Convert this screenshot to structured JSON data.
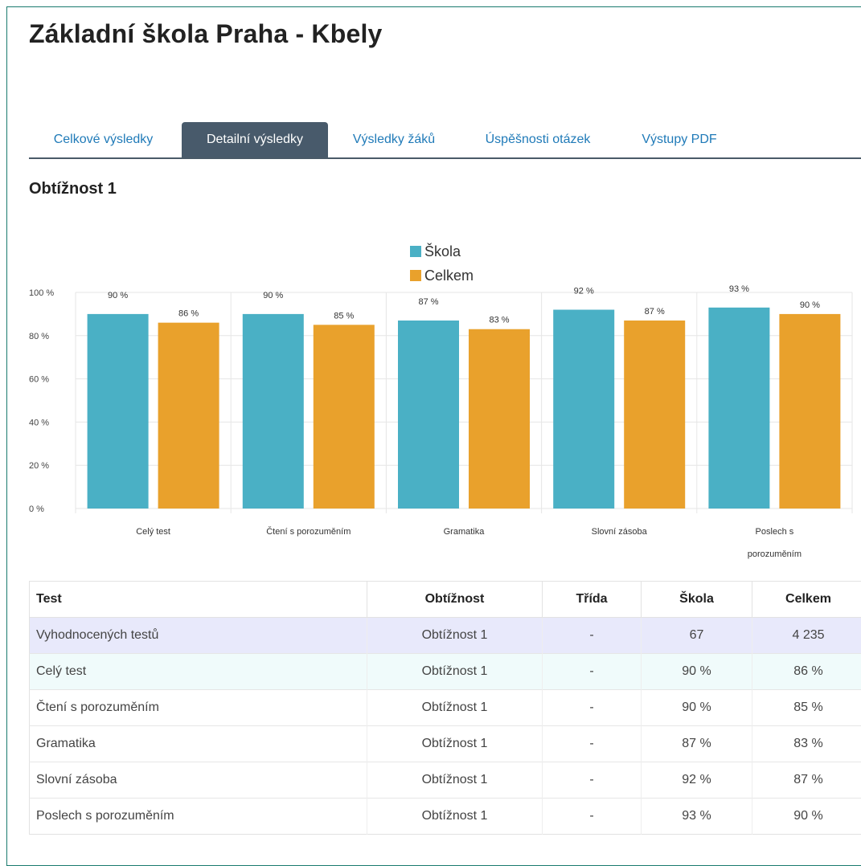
{
  "page": {
    "title": "Základní škola Praha - Kbely",
    "section_title": "Obtížnost 1"
  },
  "tabs": [
    {
      "label": "Celkové výsledky",
      "active": false
    },
    {
      "label": "Detailní výsledky",
      "active": true
    },
    {
      "label": "Výsledky žáků",
      "active": false
    },
    {
      "label": "Úspěšnosti otázek",
      "active": false
    },
    {
      "label": "Výstupy PDF",
      "active": false
    }
  ],
  "colors": {
    "skola": "#4ab0c5",
    "celkem": "#e9a12c",
    "tab_active": "#485a6b",
    "link": "#1f7ab8"
  },
  "chart_data": {
    "type": "bar",
    "categories": [
      "Celý test",
      "Čtení s porozuměním",
      "Gramatika",
      "Slovní zásoba",
      "Poslech s porozuměním"
    ],
    "category_lines": [
      [
        "Celý test"
      ],
      [
        "Čtení s porozuměním"
      ],
      [
        "Gramatika"
      ],
      [
        "Slovní zásoba"
      ],
      [
        "Poslech s",
        "porozuměním"
      ]
    ],
    "series": [
      {
        "name": "Škola",
        "values": [
          90,
          90,
          87,
          92,
          93
        ],
        "labels": [
          "90 %",
          "90 %",
          "87 %",
          "92 %",
          "93 %"
        ]
      },
      {
        "name": "Celkem",
        "values": [
          86,
          85,
          83,
          87,
          90
        ],
        "labels": [
          "86 %",
          "85 %",
          "83 %",
          "87 %",
          "90 %"
        ]
      }
    ],
    "ylim": [
      0,
      100
    ],
    "yticks": [
      0,
      20,
      40,
      60,
      80,
      100
    ],
    "ytick_labels": [
      "0 %",
      "20 %",
      "40 %",
      "60 %",
      "80 %",
      "100 %"
    ],
    "grid": true,
    "legend": "top-center"
  },
  "table": {
    "headers": [
      "Test",
      "Obtížnost",
      "Třída",
      "Škola",
      "Celkem"
    ],
    "rows": [
      [
        "Vyhodnocených testů",
        "Obtížnost 1",
        "-",
        "67",
        "4 235"
      ],
      [
        "Celý test",
        "Obtížnost 1",
        "-",
        "90 %",
        "86 %"
      ],
      [
        "Čtení s porozuměním",
        "Obtížnost 1",
        "-",
        "90 %",
        "85 %"
      ],
      [
        "Gramatika",
        "Obtížnost 1",
        "-",
        "87 %",
        "83 %"
      ],
      [
        "Slovní zásoba",
        "Obtížnost 1",
        "-",
        "92 %",
        "87 %"
      ],
      [
        "Poslech s porozuměním",
        "Obtížnost 1",
        "-",
        "93 %",
        "90 %"
      ]
    ]
  }
}
